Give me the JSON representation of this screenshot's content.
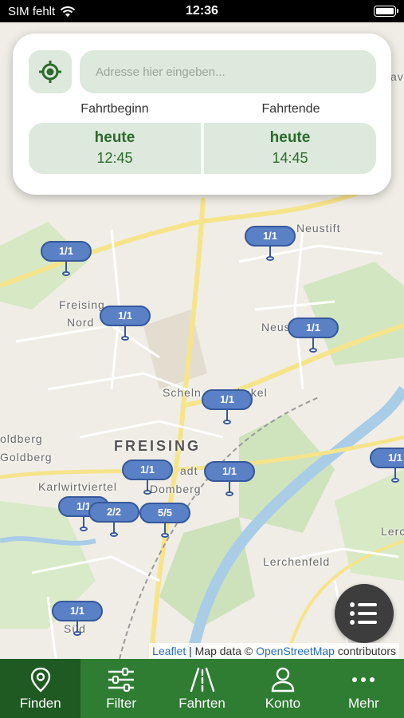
{
  "status_bar": {
    "carrier": "SIM fehlt",
    "time": "12:36"
  },
  "search_card": {
    "address_placeholder": "Adresse hier eingeben...",
    "start_label": "Fahrtbeginn",
    "end_label": "Fahrtende",
    "start": {
      "day": "heute",
      "time": "12:45"
    },
    "end": {
      "day": "heute",
      "time": "14:45"
    }
  },
  "map": {
    "labels": {
      "freising_nord_1": "Freising",
      "freising_nord_2": "Nord",
      "neustift": "Neustift",
      "neustift_2": "Neust",
      "scheln": "Scheln",
      "kekel": "kekel",
      "freising": "FREISING",
      "goldberg_1": "oldberg",
      "goldberg_2": "Goldberg",
      "karlwirtviertel": "Karlwirtviertel",
      "domberg": "Domberg",
      "adt": "adt",
      "lerchenfeld": "Lerchenfeld",
      "lerc": "Lerc",
      "sud": "Süd",
      "av": "av"
    },
    "markers": [
      {
        "label": "1/1"
      },
      {
        "label": "1/1"
      },
      {
        "label": "1/1"
      },
      {
        "label": "1/1"
      },
      {
        "label": "1/1"
      },
      {
        "label": "1/1"
      },
      {
        "label": "1/1"
      },
      {
        "label": "1/1"
      },
      {
        "label": "1/1"
      },
      {
        "label": "2/2"
      },
      {
        "label": "5/5"
      },
      {
        "label": "1/1"
      }
    ],
    "attribution": {
      "leaflet": "Leaflet",
      "sep": " | Map data © ",
      "osm": "OpenStreetMap",
      "contributors": " contributors"
    }
  },
  "tabs": [
    {
      "label": "Finden",
      "icon": "map-pin-icon",
      "active": true
    },
    {
      "label": "Filter",
      "icon": "sliders-icon"
    },
    {
      "label": "Fahrten",
      "icon": "road-icon"
    },
    {
      "label": "Konto",
      "icon": "user-icon"
    },
    {
      "label": "Mehr",
      "icon": "more-dots-icon"
    }
  ],
  "colors": {
    "tabbar": "#2f7d32",
    "tab_active": "#1f5a22",
    "accent_green": "#2d6a2d",
    "marker": "#5a80c5"
  }
}
